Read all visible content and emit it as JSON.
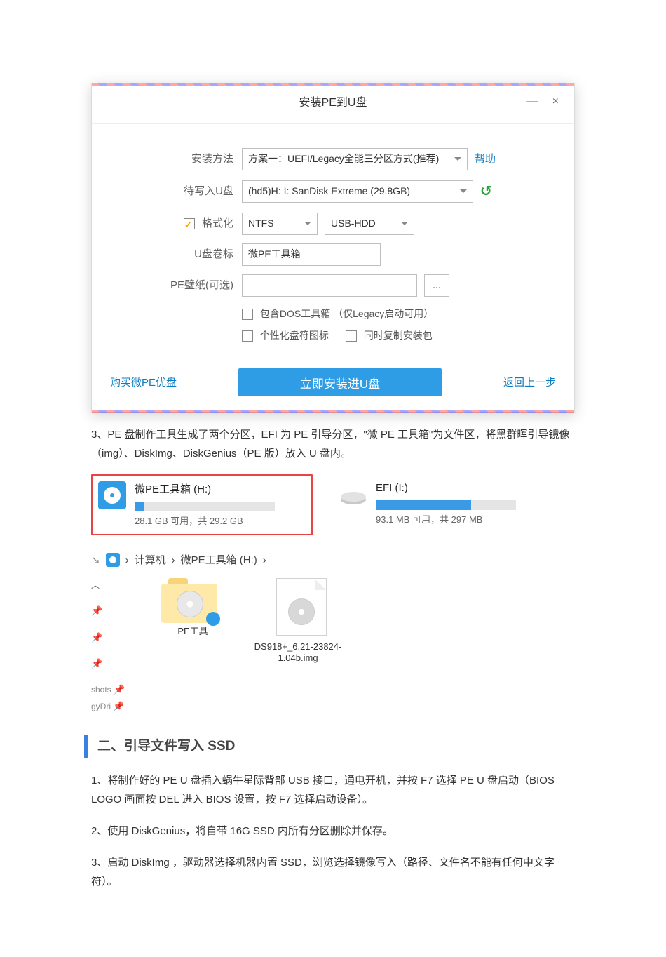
{
  "installer": {
    "title": "安装PE到U盘",
    "win_min": "—",
    "win_close": "×",
    "rows": {
      "method_label": "安装方法",
      "method_value": "方案一：UEFI/Legacy全能三分区方式(推荐)",
      "help_link": "帮助",
      "target_label": "待写入U盘",
      "target_value": "(hd5)H: I: SanDisk Extreme (29.8GB)",
      "format_label": "格式化",
      "fs_value": "NTFS",
      "mode_value": "USB-HDD",
      "vol_label": "U盘卷标",
      "vol_value": "微PE工具箱",
      "wall_label": "PE壁纸(可选)",
      "wall_value": "",
      "browse": "...",
      "dos_label": "包含DOS工具箱 （仅Legacy启动可用）",
      "icon_label": "个性化盘符图标",
      "copy_label": "同时复制安装包"
    },
    "bottom": {
      "buy": "购买微PE优盘",
      "install": "立即安装进U盘",
      "back": "返回上一步"
    }
  },
  "article": {
    "p3": "3、PE 盘制作工具生成了两个分区，EFI 为 PE 引导分区，\"微 PE 工具箱\"为文件区，将黑群晖引导镜像（img）、DiskImg、DiskGenius（PE 版）放入 U 盘内。",
    "drive1_name": "微PE工具箱 (H:)",
    "drive1_sub": "28.1 GB 可用，共 29.2 GB",
    "drive2_name": "EFI (I:)",
    "drive2_sub": "93.1 MB 可用，共 297 MB",
    "crumb_root": "计算机",
    "crumb_sep": "›",
    "crumb_here": "微PE工具箱 (H:)",
    "side_shots": "shots",
    "side_gydri": "gyDri",
    "folder_name": "PE工具",
    "file_name": "DS918+_6.21-23824-1.04b.img",
    "h2": "二、引导文件写入 SSD",
    "s1": "1、将制作好的 PE U 盘插入蜗牛星际背部 USB 接口，通电开机，并按 F7 选择 PE U 盘启动（BIOS LOGO 画面按 DEL 进入 BIOS 设置，按 F7 选择启动设备）。",
    "s2": "2、使用 DiskGenius，将自带 16G SSD 内所有分区删除并保存。",
    "s3": "3、启动 DiskImg ，驱动器选择机器内置 SSD，浏览选择镜像写入（路径、文件名不能有任何中文字符）。"
  }
}
